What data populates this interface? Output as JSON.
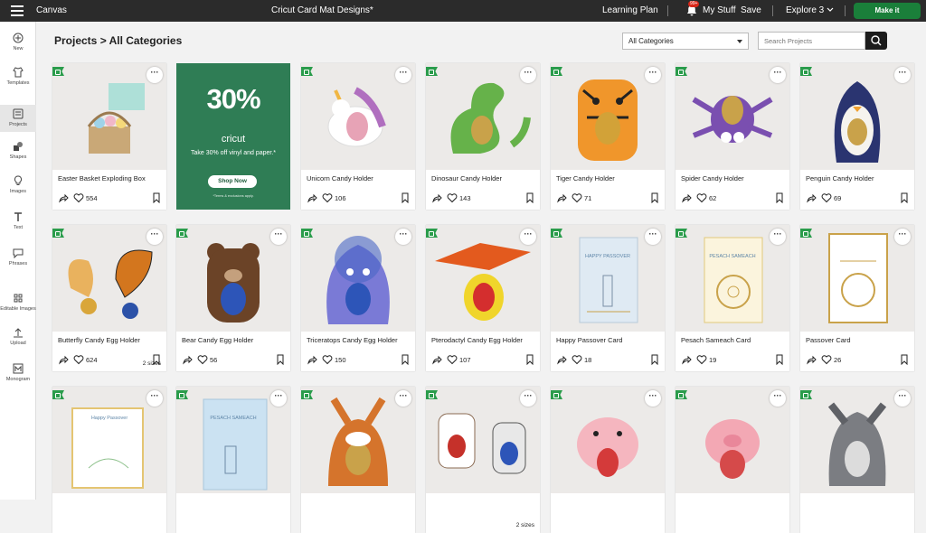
{
  "topbar": {
    "app": "Canvas",
    "doc_title": "Cricut Card Mat Designs*",
    "learning": "Learning Plan",
    "notif_badge": "99+",
    "my_stuff": "My Stuff",
    "save": "Save",
    "explore": "Explore 3",
    "make_it": "Make it"
  },
  "sidebar": {
    "items": [
      {
        "label": "New",
        "icon": "plus-circle-icon"
      },
      {
        "label": "Templates",
        "icon": "shirt-icon"
      },
      {
        "label": "Projects",
        "icon": "projects-icon"
      },
      {
        "label": "Shapes",
        "icon": "shapes-icon"
      },
      {
        "label": "Images",
        "icon": "bulb-icon"
      },
      {
        "label": "Text",
        "icon": "text-icon"
      },
      {
        "label": "Phrases",
        "icon": "speech-icon"
      },
      {
        "label": "Editable Images",
        "icon": "editable-images-icon"
      },
      {
        "label": "Upload",
        "icon": "upload-icon"
      },
      {
        "label": "Monogram",
        "icon": "monogram-icon"
      }
    ]
  },
  "header": {
    "breadcrumb": "Projects > All Categories",
    "category_select": "All Categories",
    "search_placeholder": "Search Projects"
  },
  "promo": {
    "headline": "30%",
    "brand": "cricut",
    "text": "Take 30% off vinyl and paper.*",
    "button": "Shop Now",
    "fine_print": "*Terms & exclusions apply."
  },
  "cards": [
    {
      "title": "Easter Basket Exploding Box",
      "likes": "554"
    },
    {
      "title": "Unicorn Candy Holder",
      "likes": "106"
    },
    {
      "title": "Dinosaur Candy Holder",
      "likes": "143"
    },
    {
      "title": "Tiger Candy Holder",
      "likes": "71"
    },
    {
      "title": "Spider Candy Holder",
      "likes": "62"
    },
    {
      "title": "Penguin Candy Holder",
      "likes": "69"
    },
    {
      "title": "Butterfly Candy Egg Holder",
      "likes": "624",
      "sizes": "2 sizes"
    },
    {
      "title": "Bear Candy Egg Holder",
      "likes": "56"
    },
    {
      "title": "Triceratops Candy Egg Holder",
      "likes": "150"
    },
    {
      "title": "Pterodactyl Candy Egg Holder",
      "likes": "107"
    },
    {
      "title": "Happy Passover Card",
      "likes": "18",
      "card_text": "HAPPY PASSOVER"
    },
    {
      "title": "Pesach Sameach Card",
      "likes": "19",
      "card_text": "PESACH SAMEACH"
    },
    {
      "title": "Passover Card",
      "likes": "26"
    },
    {
      "title": "",
      "likes": "",
      "card_text": "Happy Passover"
    },
    {
      "title": "",
      "likes": "",
      "card_text": "PESACH SAMEACH"
    },
    {
      "title": "",
      "likes": ""
    },
    {
      "title": "",
      "likes": "",
      "sizes": "2 sizes"
    },
    {
      "title": "",
      "likes": ""
    },
    {
      "title": "",
      "likes": ""
    },
    {
      "title": "",
      "likes": ""
    }
  ]
}
